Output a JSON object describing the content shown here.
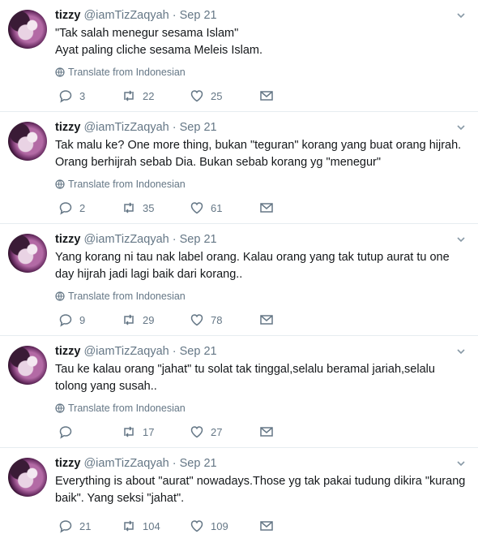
{
  "tweets": [
    {
      "name": "tizzy",
      "handle": "@iamTizZaqyah",
      "dot": "·",
      "date": "Sep 21",
      "text": "\"Tak salah menegur sesama Islam\"\nAyat paling cliche sesama Meleis Islam.",
      "translate": "Translate from Indonesian",
      "replies": "3",
      "retweets": "22",
      "likes": "25"
    },
    {
      "name": "tizzy",
      "handle": "@iamTizZaqyah",
      "dot": "·",
      "date": "Sep 21",
      "text": "Tak malu ke? One more thing, bukan \"teguran\" korang yang buat orang hijrah. Orang berhijrah sebab Dia. Bukan sebab korang yg \"menegur\"",
      "translate": "Translate from Indonesian",
      "replies": "2",
      "retweets": "35",
      "likes": "61"
    },
    {
      "name": "tizzy",
      "handle": "@iamTizZaqyah",
      "dot": "·",
      "date": "Sep 21",
      "text": "Yang korang ni tau nak label orang. Kalau orang yang tak tutup aurat tu one day hijrah jadi lagi baik dari korang..",
      "translate": "Translate from Indonesian",
      "replies": "9",
      "retweets": "29",
      "likes": "78"
    },
    {
      "name": "tizzy",
      "handle": "@iamTizZaqyah",
      "dot": "·",
      "date": "Sep 21",
      "text": "Tau ke kalau orang \"jahat\" tu solat tak tinggal,selalu beramal jariah,selalu tolong yang susah..",
      "translate": "Translate from Indonesian",
      "replies": "",
      "retweets": "17",
      "likes": "27"
    },
    {
      "name": "tizzy",
      "handle": "@iamTizZaqyah",
      "dot": "·",
      "date": "Sep 21",
      "text": "Everything is about \"aurat\" nowadays.Those yg tak pakai tudung dikira \"kurang baik\". Yang seksi \"jahat\".",
      "translate": "",
      "replies": "21",
      "retweets": "104",
      "likes": "109"
    }
  ],
  "icons": {
    "caret": "chevron-down-icon",
    "translate": "globe-icon",
    "reply": "reply-icon",
    "retweet": "retweet-icon",
    "like": "heart-icon",
    "dm": "envelope-icon"
  }
}
